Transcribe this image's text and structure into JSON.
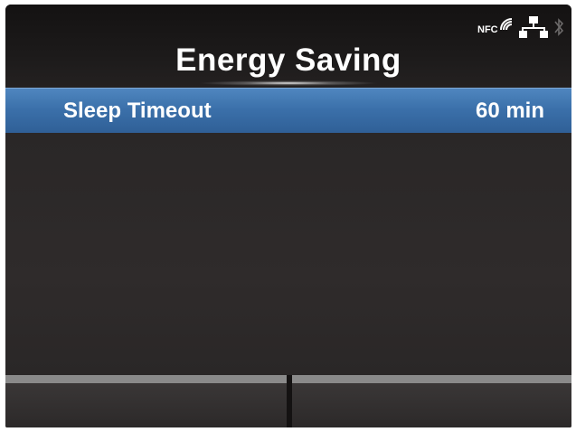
{
  "header": {
    "title": "Energy Saving",
    "status_icons": [
      "nfc-icon",
      "network-icon",
      "bluetooth-icon"
    ],
    "nfc_label": "NFC"
  },
  "menu": {
    "items": [
      {
        "label": "Sleep Timeout",
        "value": "60 min",
        "selected": true
      }
    ]
  },
  "softkeys": {
    "left_label": "",
    "right_label": ""
  },
  "colors": {
    "background": "#2a2727",
    "selection": "#3b70aa",
    "text": "#ffffff"
  }
}
